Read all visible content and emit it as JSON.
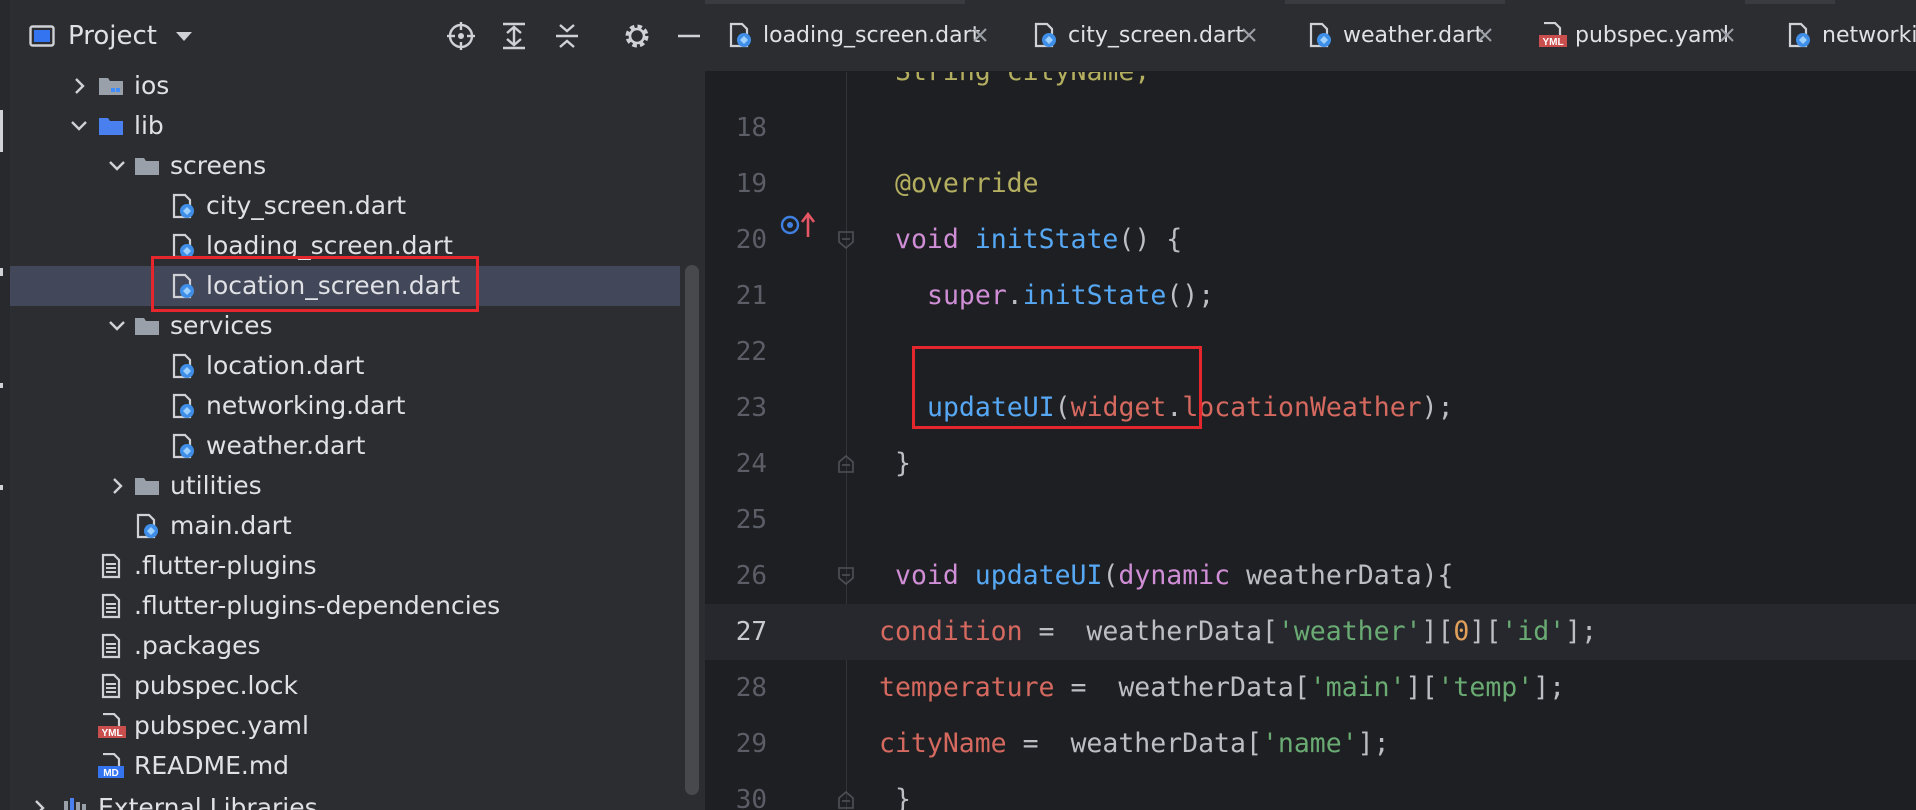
{
  "project_panel": {
    "title": "Project",
    "tree": [
      {
        "label": "ios",
        "icon": "folder-icon",
        "expanded": false
      },
      {
        "label": "lib",
        "icon": "folder-icon",
        "expanded": true
      },
      {
        "label": "screens",
        "icon": "folder-icon",
        "expanded": true
      },
      {
        "label": "city_screen.dart",
        "icon": "dart-file-icon"
      },
      {
        "label": "loading_screen.dart",
        "icon": "dart-file-icon"
      },
      {
        "label": "location_screen.dart",
        "icon": "dart-file-icon",
        "selected": true
      },
      {
        "label": "services",
        "icon": "folder-icon",
        "expanded": true
      },
      {
        "label": "location.dart",
        "icon": "dart-file-icon"
      },
      {
        "label": "networking.dart",
        "icon": "dart-file-icon"
      },
      {
        "label": "weather.dart",
        "icon": "dart-file-icon"
      },
      {
        "label": "utilities",
        "icon": "folder-icon",
        "expanded": false
      },
      {
        "label": "main.dart",
        "icon": "dart-file-icon"
      },
      {
        "label": ".flutter-plugins",
        "icon": "text-file-icon"
      },
      {
        "label": ".flutter-plugins-dependencies",
        "icon": "text-file-icon"
      },
      {
        "label": ".packages",
        "icon": "text-file-icon"
      },
      {
        "label": "pubspec.lock",
        "icon": "text-file-icon"
      },
      {
        "label": "pubspec.yaml",
        "icon": "yaml-file-icon"
      },
      {
        "label": "README.md",
        "icon": "markdown-file-icon"
      },
      {
        "label": "External Libraries",
        "icon": "library-icon",
        "expanded": false
      }
    ]
  },
  "tabs": [
    {
      "label": "loading_screen.dart",
      "icon": "dart-file-icon"
    },
    {
      "label": "city_screen.dart",
      "icon": "dart-file-icon"
    },
    {
      "label": "weather.dart",
      "icon": "dart-file-icon"
    },
    {
      "label": "pubspec.yaml",
      "icon": "yaml-file-icon"
    },
    {
      "label": "networking",
      "icon": "dart-file-icon"
    }
  ],
  "icon_text": {
    "yaml": "YML",
    "markdown": "MD"
  },
  "editor": {
    "current_line": "27",
    "lines": [
      {
        "n": "18",
        "t": []
      },
      {
        "n": "19",
        "t": [
          "@override"
        ]
      },
      {
        "n": "20",
        "t": [
          "void",
          " ",
          "initState",
          "() {"
        ]
      },
      {
        "n": "21",
        "t": [
          "super",
          ".",
          "initState",
          "();"
        ]
      },
      {
        "n": "22",
        "t": []
      },
      {
        "n": "23",
        "t": [
          "updateUI",
          "(",
          "widget",
          ".",
          "locationWeather",
          ");"
        ]
      },
      {
        "n": "24",
        "t": [
          "}"
        ]
      },
      {
        "n": "25",
        "t": []
      },
      {
        "n": "26",
        "t": [
          "void",
          " ",
          "updateUI",
          "(",
          "dynamic",
          " ",
          "weatherData",
          "){"
        ]
      },
      {
        "n": "27",
        "t": [
          "condition",
          " =  ",
          "weatherData",
          "[",
          "'weather'",
          "][",
          "0",
          "][",
          "'id'",
          "];"
        ]
      },
      {
        "n": "28",
        "t": [
          "temperature",
          " =  ",
          "weatherData",
          "[",
          "'main'",
          "][",
          "'temp'",
          "];"
        ]
      },
      {
        "n": "29",
        "t": [
          "cityName",
          " =  ",
          "weatherData",
          "[",
          "'name'",
          "];"
        ]
      },
      {
        "n": "30",
        "t": [
          "}"
        ]
      }
    ]
  },
  "colors": {
    "background": "#1e1f22",
    "panel": "#2b2d30",
    "selection": "#43475a",
    "highlight_box": "#e5262c",
    "keyword": "#cf8ed6",
    "function": "#56a8f5",
    "string": "#6aab73",
    "number": "#e09f5a",
    "field": "#d5695f",
    "annotation": "#b3ae60"
  }
}
